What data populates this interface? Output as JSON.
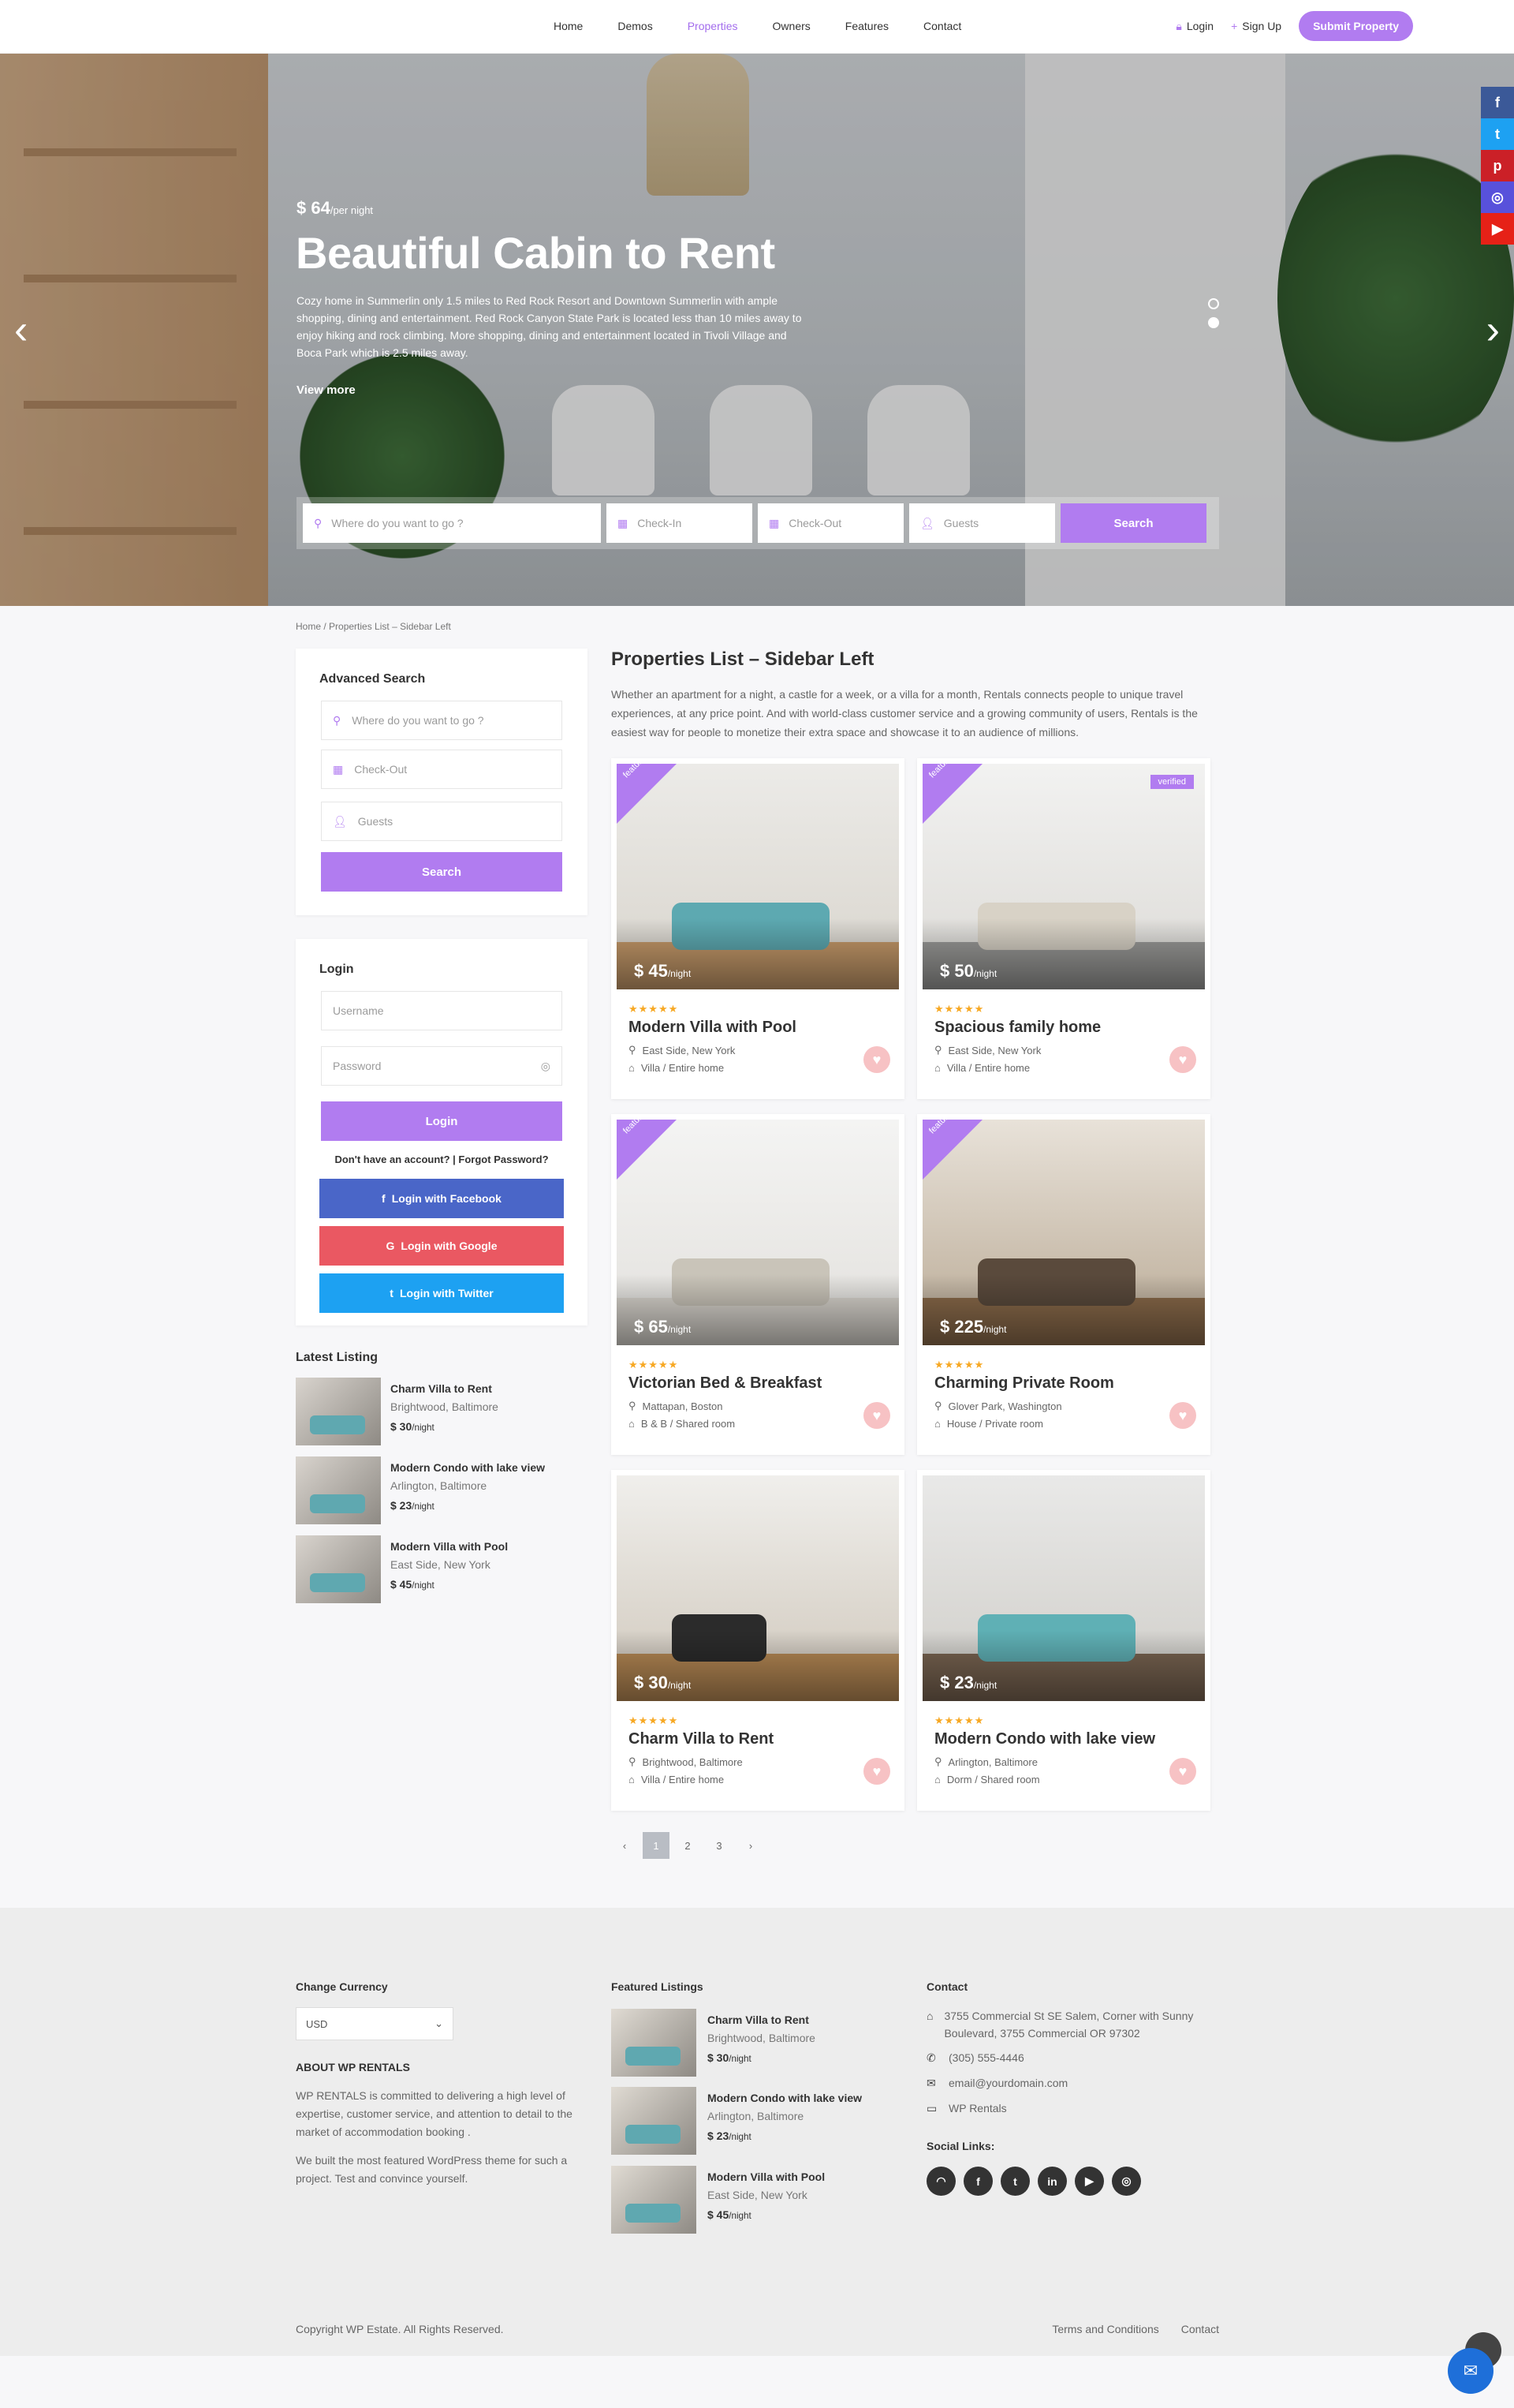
{
  "colors": {
    "accent": "#b17cf0",
    "facebook": "#4a66c8",
    "google": "#ea5862",
    "twitter": "#1da1f2"
  },
  "header": {
    "nav": [
      "Home",
      "Demos",
      "Properties",
      "Owners",
      "Features",
      "Contact"
    ],
    "active": "Properties",
    "login": "Login",
    "signup": "Sign Up",
    "submit": "Submit Property"
  },
  "hero": {
    "price": "$ 64",
    "per": "/per night",
    "title": "Beautiful Cabin to Rent",
    "description": "Cozy home in Summerlin only 1.5 miles to Red Rock Resort and Downtown Summerlin with ample shopping, dining and entertainment. Red Rock Canyon State Park is located less than 10 miles away to enjoy hiking and rock climbing. More shopping, dining and entertainment located in Tivoli Village and Boca Park which is 2.5 miles away.",
    "view_more": "View more",
    "search": {
      "where": "Where do you want to go ?",
      "checkin": "Check-In",
      "checkout": "Check-Out",
      "guests": "Guests",
      "button": "Search"
    }
  },
  "social_side": [
    "f",
    "t",
    "p",
    "ig",
    "yt"
  ],
  "breadcrumb": {
    "home": "Home",
    "current": "Properties List – Sidebar Left"
  },
  "sidebar": {
    "advanced": {
      "title": "Advanced Search",
      "where": "Where do you want to go ?",
      "checkout": "Check-Out",
      "guests": "Guests",
      "button": "Search"
    },
    "login": {
      "title": "Login",
      "username": "Username",
      "password": "Password",
      "button": "Login",
      "links": "Don't have an account? | Forgot Password?",
      "facebook": "Login with Facebook",
      "google": "Login with Google",
      "twitter": "Login with Twitter"
    },
    "latest": {
      "title": "Latest Listing",
      "items": [
        {
          "title": "Charm Villa to Rent",
          "area": "Brightwood, Baltimore",
          "price": "$ 30",
          "per": "/night"
        },
        {
          "title": "Modern Condo with lake view",
          "area": "Arlington, Baltimore",
          "price": "$ 23",
          "per": "/night"
        },
        {
          "title": "Modern Villa with Pool",
          "area": "East Side, New York",
          "price": "$ 45",
          "per": "/night"
        }
      ]
    }
  },
  "main": {
    "title": "Properties List – Sidebar Left",
    "description": "Whether an apartment for a night, a castle for a week, or a villa for a month, Rentals connects people to unique travel experiences, at any price point. And with world-class customer service and a growing community of users, Rentals is the easiest way for people to monetize their extra space and showcase it to an audience of millions.",
    "stars": "★★★★★",
    "featured_label": "featured",
    "verified_label": "verified",
    "listings": [
      {
        "price": "$ 45",
        "per": "/night",
        "title": "Modern Villa with Pool",
        "location": "East Side, New York",
        "type": "Villa / Entire home"
      },
      {
        "price": "$ 50",
        "per": "/night",
        "title": "Spacious family home",
        "location": "East Side, New York",
        "type": "Villa / Entire home"
      },
      {
        "price": "$ 65",
        "per": "/night",
        "title": "Victorian Bed & Breakfast",
        "location": "Mattapan, Boston",
        "type": "B & B / Shared room"
      },
      {
        "price": "$ 225",
        "per": "/night",
        "title": "Charming Private Room",
        "location": "Glover Park, Washington",
        "type": "House / Private room"
      },
      {
        "price": "$ 30",
        "per": "/night",
        "title": "Charm Villa to Rent",
        "location": "Brightwood, Baltimore",
        "type": "Villa / Entire home"
      },
      {
        "price": "$ 23",
        "per": "/night",
        "title": "Modern Condo with lake view",
        "location": "Arlington, Baltimore",
        "type": "Dorm / Shared room"
      }
    ],
    "pagination": [
      "‹",
      "1",
      "2",
      "3",
      "›"
    ]
  },
  "footer": {
    "currency_title": "Change Currency",
    "currency": "USD",
    "about_title": "ABOUT WP RENTALS",
    "about_1": "WP RENTALS is committed to delivering a high level of expertise, customer service, and attention to detail to the market of accommodation booking .",
    "about_2": "We built the most featured WordPress theme for such a project. Test and convince yourself.",
    "featured_title": "Featured Listings",
    "featured": [
      {
        "title": "Charm Villa to Rent",
        "area": "Brightwood, Baltimore",
        "price": "$ 30",
        "per": "/night"
      },
      {
        "title": "Modern Condo with lake view",
        "area": "Arlington, Baltimore",
        "price": "$ 23",
        "per": "/night"
      },
      {
        "title": "Modern Villa with Pool",
        "area": "East Side, New York",
        "price": "$ 45",
        "per": "/night"
      }
    ],
    "contact_title": "Contact",
    "address": "3755 Commercial St SE Salem, Corner with Sunny Boulevard, 3755 Commercial OR 97302",
    "phone": "(305) 555-4446",
    "email": "email@yourdomain.com",
    "site": "WP Rentals",
    "social_title": "Social Links:",
    "copyright": "Copyright WP Estate. All Rights Reserved.",
    "terms": "Terms and Conditions",
    "contact_link": "Contact"
  }
}
